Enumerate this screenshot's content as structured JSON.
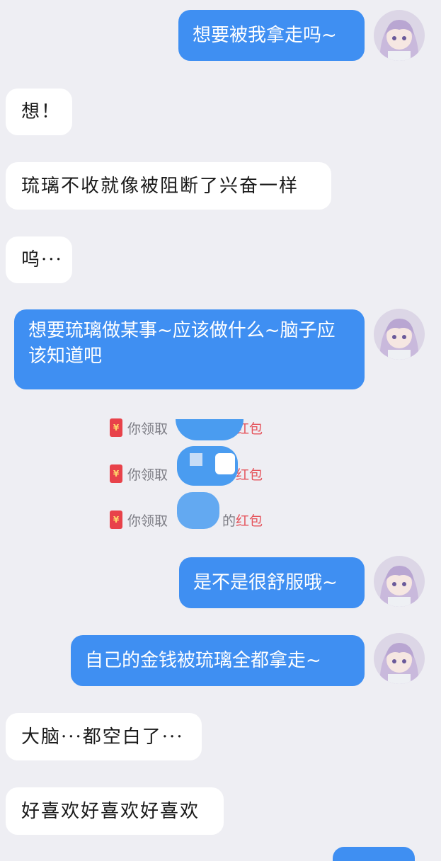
{
  "messages": [
    {
      "text": "想要被我拿走吗~"
    },
    {
      "text": "想！"
    },
    {
      "text": "琉璃不收就像被阻断了兴奋一样"
    },
    {
      "text": "呜···"
    },
    {
      "text": "想要琉璃做某事~应该做什么~脑子应该知道吧"
    },
    {
      "text": "是不是很舒服哦~"
    },
    {
      "text": "自己的金钱被琉璃全都拿走~"
    },
    {
      "text": "大脑···都空白了···"
    },
    {
      "text": "好喜欢好喜欢好喜欢"
    }
  ],
  "system_notices": [
    {
      "prefix": "你领取",
      "middle": "",
      "suffix": "红包"
    },
    {
      "prefix": "你领取",
      "middle": "",
      "suffix": "红包"
    },
    {
      "prefix": "你领取",
      "middle": "的",
      "suffix": "红包"
    }
  ],
  "icons": {
    "red_packet": "¥",
    "avatar": "anime-girl-avatar"
  },
  "colors": {
    "background": "#eeeef3",
    "outgoing_bubble": "#3f8ff2",
    "incoming_bubble": "#ffffff",
    "red_packet": "#e8424a",
    "redacted": "#4a9cf0"
  }
}
